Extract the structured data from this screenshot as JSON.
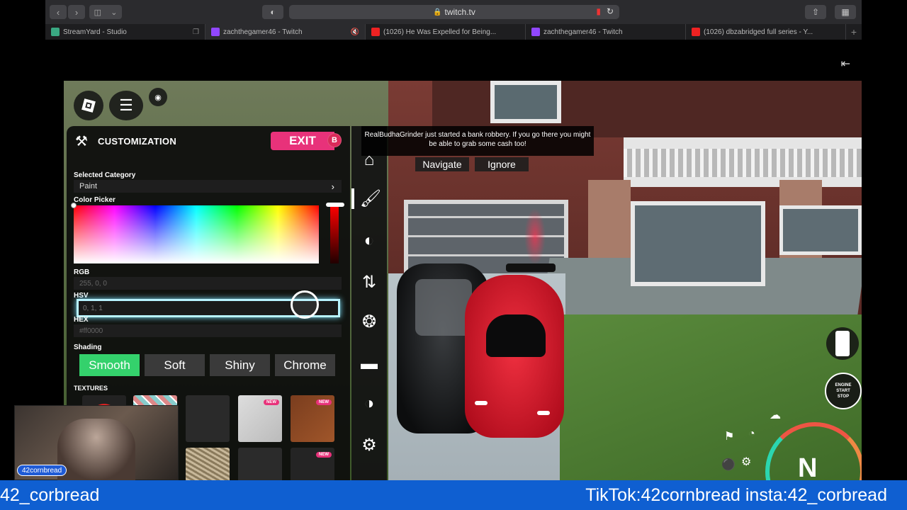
{
  "browser": {
    "url": "twitch.tv",
    "tabs": [
      {
        "title": "StreamYard - Studio",
        "favicon": "streamyard-icon"
      },
      {
        "title": "zachthegamer46 - Twitch",
        "favicon": "twitch-icon"
      },
      {
        "title": "(1026) He Was Expelled for Being...",
        "favicon": "youtube-icon"
      },
      {
        "title": "zachthegamer46 - Twitch",
        "favicon": "twitch-icon"
      },
      {
        "title": "(1026) dbzabridged full series - Y...",
        "favicon": "youtube-icon"
      }
    ]
  },
  "panel": {
    "title": "CUSTOMIZATION",
    "exit_label": "EXIT",
    "exit_key": "B",
    "selected_category_label": "Selected Category",
    "selected_category_value": "Paint",
    "color_picker_label": "Color Picker",
    "rgb_label": "RGB",
    "rgb_value": "255, 0, 0",
    "hsv_label": "HSV",
    "hsv_value": "0, 1, 1",
    "hex_label": "HEX",
    "hex_value": "#ff0000",
    "shading_label": "Shading",
    "shading_options": [
      "Smooth",
      "Soft",
      "Shiny",
      "Chrome"
    ],
    "shading_selected": "Smooth",
    "textures_label": "TEXTURES",
    "new_badge": "NEW"
  },
  "notification": {
    "message": "RealBudhaGrinder just started a bank robbery. If you go there you might be able to grab some cash too!",
    "navigate_label": "Navigate",
    "ignore_label": "Ignore"
  },
  "hud": {
    "engine_line1": "ENGINE",
    "engine_line2": "START",
    "engine_line3": "STOP",
    "gear": "N"
  },
  "stream": {
    "webcam_tag": "42cornbread",
    "ticker_left": "42_corbread",
    "ticker_right": "TikTok:42cornbread insta:42_corbread"
  },
  "colors": {
    "accent_pink": "#e8327a",
    "selected_green": "#34d16c",
    "ticker_blue": "#0f5fd1"
  }
}
